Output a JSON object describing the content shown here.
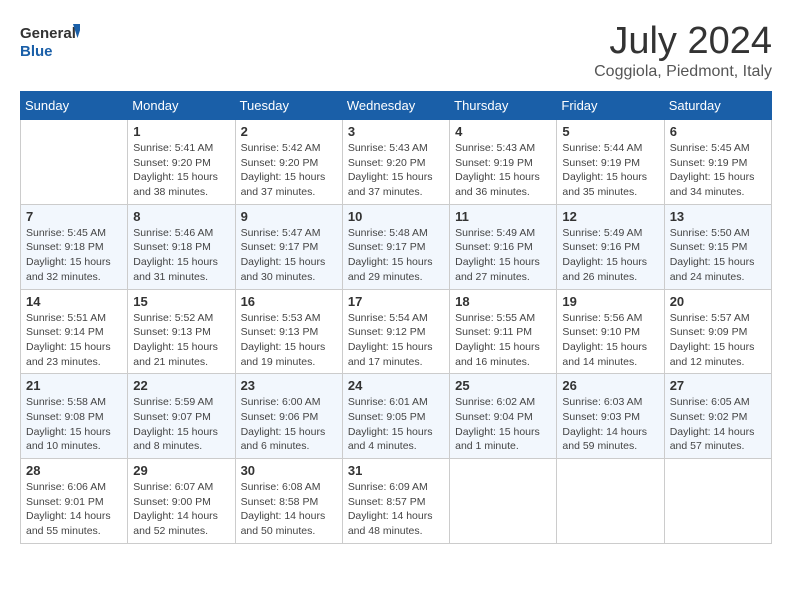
{
  "header": {
    "logo_line1": "General",
    "logo_line2": "Blue",
    "month_title": "July 2024",
    "location": "Coggiola, Piedmont, Italy"
  },
  "weekdays": [
    "Sunday",
    "Monday",
    "Tuesday",
    "Wednesday",
    "Thursday",
    "Friday",
    "Saturday"
  ],
  "weeks": [
    [
      {
        "day": "",
        "sunrise": "",
        "sunset": "",
        "daylight": ""
      },
      {
        "day": "1",
        "sunrise": "Sunrise: 5:41 AM",
        "sunset": "Sunset: 9:20 PM",
        "daylight": "Daylight: 15 hours and 38 minutes."
      },
      {
        "day": "2",
        "sunrise": "Sunrise: 5:42 AM",
        "sunset": "Sunset: 9:20 PM",
        "daylight": "Daylight: 15 hours and 37 minutes."
      },
      {
        "day": "3",
        "sunrise": "Sunrise: 5:43 AM",
        "sunset": "Sunset: 9:20 PM",
        "daylight": "Daylight: 15 hours and 37 minutes."
      },
      {
        "day": "4",
        "sunrise": "Sunrise: 5:43 AM",
        "sunset": "Sunset: 9:19 PM",
        "daylight": "Daylight: 15 hours and 36 minutes."
      },
      {
        "day": "5",
        "sunrise": "Sunrise: 5:44 AM",
        "sunset": "Sunset: 9:19 PM",
        "daylight": "Daylight: 15 hours and 35 minutes."
      },
      {
        "day": "6",
        "sunrise": "Sunrise: 5:45 AM",
        "sunset": "Sunset: 9:19 PM",
        "daylight": "Daylight: 15 hours and 34 minutes."
      }
    ],
    [
      {
        "day": "7",
        "sunrise": "Sunrise: 5:45 AM",
        "sunset": "Sunset: 9:18 PM",
        "daylight": "Daylight: 15 hours and 32 minutes."
      },
      {
        "day": "8",
        "sunrise": "Sunrise: 5:46 AM",
        "sunset": "Sunset: 9:18 PM",
        "daylight": "Daylight: 15 hours and 31 minutes."
      },
      {
        "day": "9",
        "sunrise": "Sunrise: 5:47 AM",
        "sunset": "Sunset: 9:17 PM",
        "daylight": "Daylight: 15 hours and 30 minutes."
      },
      {
        "day": "10",
        "sunrise": "Sunrise: 5:48 AM",
        "sunset": "Sunset: 9:17 PM",
        "daylight": "Daylight: 15 hours and 29 minutes."
      },
      {
        "day": "11",
        "sunrise": "Sunrise: 5:49 AM",
        "sunset": "Sunset: 9:16 PM",
        "daylight": "Daylight: 15 hours and 27 minutes."
      },
      {
        "day": "12",
        "sunrise": "Sunrise: 5:49 AM",
        "sunset": "Sunset: 9:16 PM",
        "daylight": "Daylight: 15 hours and 26 minutes."
      },
      {
        "day": "13",
        "sunrise": "Sunrise: 5:50 AM",
        "sunset": "Sunset: 9:15 PM",
        "daylight": "Daylight: 15 hours and 24 minutes."
      }
    ],
    [
      {
        "day": "14",
        "sunrise": "Sunrise: 5:51 AM",
        "sunset": "Sunset: 9:14 PM",
        "daylight": "Daylight: 15 hours and 23 minutes."
      },
      {
        "day": "15",
        "sunrise": "Sunrise: 5:52 AM",
        "sunset": "Sunset: 9:13 PM",
        "daylight": "Daylight: 15 hours and 21 minutes."
      },
      {
        "day": "16",
        "sunrise": "Sunrise: 5:53 AM",
        "sunset": "Sunset: 9:13 PM",
        "daylight": "Daylight: 15 hours and 19 minutes."
      },
      {
        "day": "17",
        "sunrise": "Sunrise: 5:54 AM",
        "sunset": "Sunset: 9:12 PM",
        "daylight": "Daylight: 15 hours and 17 minutes."
      },
      {
        "day": "18",
        "sunrise": "Sunrise: 5:55 AM",
        "sunset": "Sunset: 9:11 PM",
        "daylight": "Daylight: 15 hours and 16 minutes."
      },
      {
        "day": "19",
        "sunrise": "Sunrise: 5:56 AM",
        "sunset": "Sunset: 9:10 PM",
        "daylight": "Daylight: 15 hours and 14 minutes."
      },
      {
        "day": "20",
        "sunrise": "Sunrise: 5:57 AM",
        "sunset": "Sunset: 9:09 PM",
        "daylight": "Daylight: 15 hours and 12 minutes."
      }
    ],
    [
      {
        "day": "21",
        "sunrise": "Sunrise: 5:58 AM",
        "sunset": "Sunset: 9:08 PM",
        "daylight": "Daylight: 15 hours and 10 minutes."
      },
      {
        "day": "22",
        "sunrise": "Sunrise: 5:59 AM",
        "sunset": "Sunset: 9:07 PM",
        "daylight": "Daylight: 15 hours and 8 minutes."
      },
      {
        "day": "23",
        "sunrise": "Sunrise: 6:00 AM",
        "sunset": "Sunset: 9:06 PM",
        "daylight": "Daylight: 15 hours and 6 minutes."
      },
      {
        "day": "24",
        "sunrise": "Sunrise: 6:01 AM",
        "sunset": "Sunset: 9:05 PM",
        "daylight": "Daylight: 15 hours and 4 minutes."
      },
      {
        "day": "25",
        "sunrise": "Sunrise: 6:02 AM",
        "sunset": "Sunset: 9:04 PM",
        "daylight": "Daylight: 15 hours and 1 minute."
      },
      {
        "day": "26",
        "sunrise": "Sunrise: 6:03 AM",
        "sunset": "Sunset: 9:03 PM",
        "daylight": "Daylight: 14 hours and 59 minutes."
      },
      {
        "day": "27",
        "sunrise": "Sunrise: 6:05 AM",
        "sunset": "Sunset: 9:02 PM",
        "daylight": "Daylight: 14 hours and 57 minutes."
      }
    ],
    [
      {
        "day": "28",
        "sunrise": "Sunrise: 6:06 AM",
        "sunset": "Sunset: 9:01 PM",
        "daylight": "Daylight: 14 hours and 55 minutes."
      },
      {
        "day": "29",
        "sunrise": "Sunrise: 6:07 AM",
        "sunset": "Sunset: 9:00 PM",
        "daylight": "Daylight: 14 hours and 52 minutes."
      },
      {
        "day": "30",
        "sunrise": "Sunrise: 6:08 AM",
        "sunset": "Sunset: 8:58 PM",
        "daylight": "Daylight: 14 hours and 50 minutes."
      },
      {
        "day": "31",
        "sunrise": "Sunrise: 6:09 AM",
        "sunset": "Sunset: 8:57 PM",
        "daylight": "Daylight: 14 hours and 48 minutes."
      },
      {
        "day": "",
        "sunrise": "",
        "sunset": "",
        "daylight": ""
      },
      {
        "day": "",
        "sunrise": "",
        "sunset": "",
        "daylight": ""
      },
      {
        "day": "",
        "sunrise": "",
        "sunset": "",
        "daylight": ""
      }
    ]
  ]
}
